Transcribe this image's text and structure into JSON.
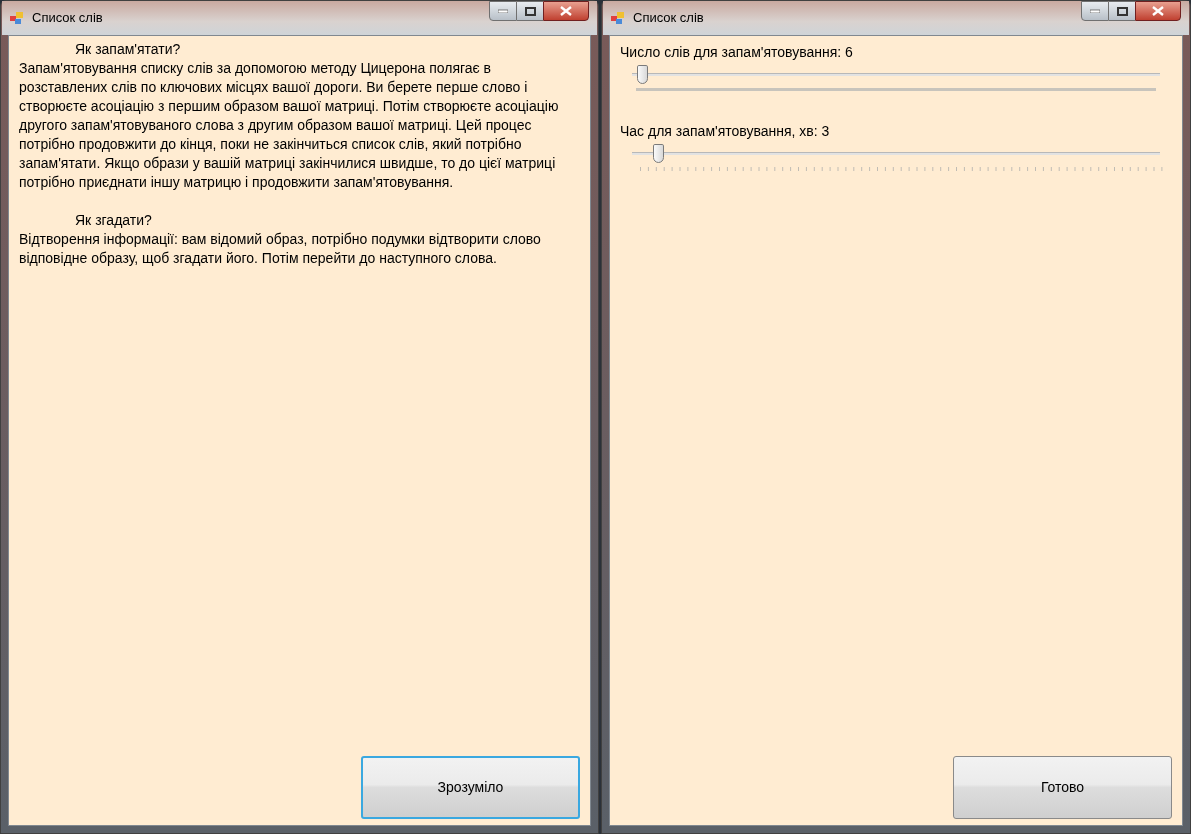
{
  "windows": [
    {
      "title": "Список слів",
      "kind": "info",
      "sections": [
        {
          "heading": "Як запам'ятати?",
          "body": "Запам'ятовування списку слів за допомогою методу Цицерона полягає в розставлених слів по ключових місцях вашої дороги. Ви берете перше слово і створюєте асоціацію з першим образом вашої матриці. Потім створюєте асоціацію другого запам'ятовуваного слова з другим образом вашої матриці. Цей процес потрібно продовжити до кінця, поки не закінчиться список слів, який потрібно запам'ятати. Якщо образи у вашій матриці закінчилися швидше, то до цієї матриці потрібно приєднати іншу матрицю і продовжити запам'ятовування."
        },
        {
          "heading": "Як згадати?",
          "body": "Відтворення інформації: вам відомий образ, потрібно подумки відтворити слово відповідне образу, щоб згадати його. Потім перейти до наступного слова."
        }
      ],
      "button": {
        "label": "Зрозуміло",
        "focused": true
      }
    },
    {
      "title": "Список слів",
      "kind": "settings",
      "sliders": [
        {
          "label": "Число слів для запам'ятовування: 6",
          "level": 0.01,
          "kind": "bar"
        },
        {
          "label": "Час для запам'ятовування, хв: 3",
          "level": 0.04,
          "kind": "ticks"
        }
      ],
      "button": {
        "label": "Готово",
        "focused": false
      }
    }
  ]
}
